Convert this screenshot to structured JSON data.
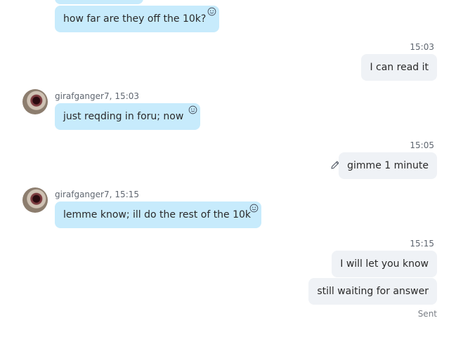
{
  "messages": [
    {
      "text": "",
      "partial": true
    },
    {
      "text": "how far are they off the 10k?"
    },
    {
      "time": "15:03",
      "text": "I can read it"
    },
    {
      "sender": "girafganger7,",
      "time": "15:03",
      "text": "just reqding in foru; now"
    },
    {
      "time": "15:05",
      "text": "gimme 1 minute"
    },
    {
      "sender": "girafganger7,",
      "time": "15:15",
      "text": "lemme know; ill do the rest of the 10k"
    },
    {
      "time": "15:15",
      "text": "I will let you know"
    },
    {
      "text": "still waiting for answer",
      "status": "Sent"
    }
  ],
  "icons": {
    "reaction": "smiley-icon",
    "edit": "pencil-icon",
    "avatar": "user-avatar"
  }
}
